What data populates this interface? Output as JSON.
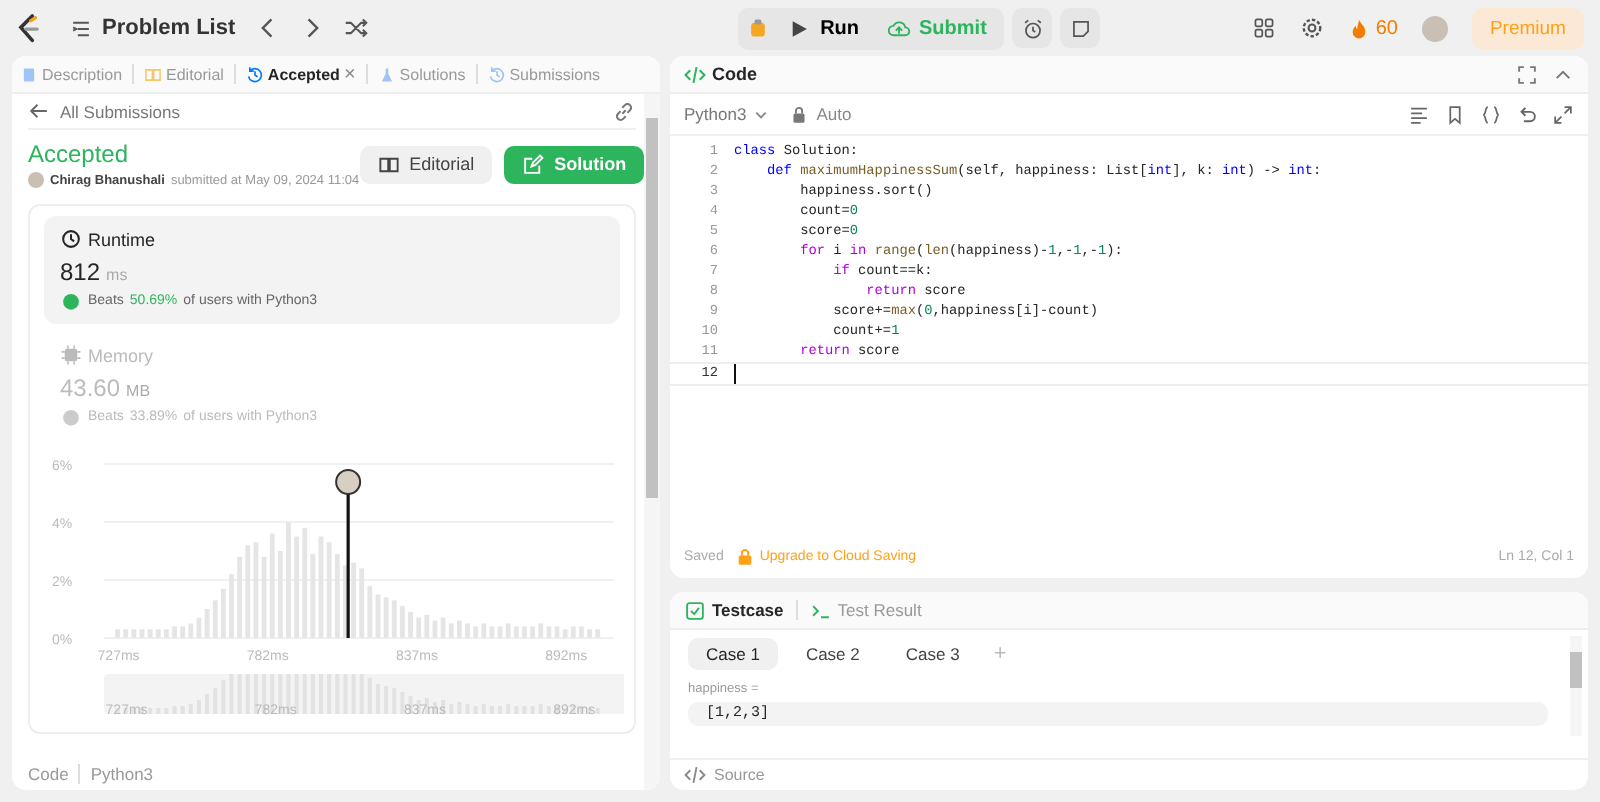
{
  "topbar": {
    "problem_list": "Problem List",
    "run": "Run",
    "submit": "Submit",
    "streak": "60",
    "premium": "Premium"
  },
  "left_tabs": [
    {
      "label": "Description",
      "selected": false,
      "closable": false
    },
    {
      "label": "Editorial",
      "selected": false,
      "closable": false
    },
    {
      "label": "Accepted",
      "selected": true,
      "closable": true,
      "close": "×"
    },
    {
      "label": "Solutions",
      "selected": false,
      "closable": false
    },
    {
      "label": "Submissions",
      "selected": false,
      "closable": false
    }
  ],
  "back_link": "All Submissions",
  "submission": {
    "status": "Accepted",
    "author": "Chirag Bhanushali",
    "submitted": "submitted at May 09, 2024 11:04",
    "buttons": [
      {
        "label": "Editorial",
        "kind": "secondary"
      },
      {
        "label": "Solution",
        "kind": "primary"
      }
    ]
  },
  "metrics": [
    {
      "title": "Runtime",
      "value": "812",
      "unit": "ms",
      "beats": "Beats",
      "percent": "50.69%",
      "rest": "of users with Python3",
      "selected": true
    },
    {
      "title": "Memory",
      "value": "43.60",
      "unit": "MB",
      "beats": "Beats",
      "percent": "33.89%",
      "rest": "of users with Python3",
      "selected": false
    }
  ],
  "chart_data": {
    "type": "bar",
    "x": [
      727,
      730,
      733,
      736,
      739,
      742,
      745,
      748,
      751,
      754,
      757,
      760,
      763,
      766,
      769,
      772,
      775,
      778,
      781,
      784,
      787,
      790,
      793,
      796,
      799,
      802,
      805,
      808,
      811,
      814,
      817,
      820,
      823,
      826,
      829,
      832,
      835,
      838,
      841,
      844,
      847,
      850,
      853,
      856,
      859,
      862,
      865,
      868,
      871,
      874,
      877,
      880,
      883,
      886,
      889,
      892,
      895,
      898,
      901,
      904
    ],
    "series": [
      {
        "color": "#e5e5e5",
        "values": [
          0.3,
          0.3,
          0.3,
          0.3,
          0.3,
          0.3,
          0.3,
          0.4,
          0.4,
          0.5,
          0.7,
          1.0,
          1.3,
          1.7,
          2.2,
          2.8,
          3.2,
          3.3,
          2.8,
          3.6,
          3.0,
          4.0,
          3.5,
          3.8,
          2.9,
          3.5,
          3.3,
          2.9,
          2.5,
          2.6,
          2.4,
          1.8,
          1.5,
          1.4,
          1.3,
          1.1,
          0.9,
          0.7,
          0.8,
          0.6,
          0.7,
          0.5,
          0.6,
          0.5,
          0.4,
          0.5,
          0.4,
          0.4,
          0.5,
          0.4,
          0.4,
          0.4,
          0.5,
          0.4,
          0.4,
          0.3,
          0.4,
          0.4,
          0.3,
          0.3
        ]
      }
    ],
    "xlim": [
      722,
      910
    ],
    "ylim": [
      0,
      6
    ],
    "xticks": [
      {
        "value": 727,
        "label": "727ms"
      },
      {
        "value": 782,
        "label": "782ms"
      },
      {
        "value": 837,
        "label": "837ms"
      },
      {
        "value": 892,
        "label": "892ms"
      }
    ],
    "yticks": [
      {
        "value": 0,
        "label": "0%"
      },
      {
        "value": 2,
        "label": "2%"
      },
      {
        "value": 4,
        "label": "4%"
      },
      {
        "value": 6,
        "label": "6%"
      }
    ]
  },
  "navigator": {
    "labels": [
      "727ms",
      "782ms",
      "837ms",
      "892ms"
    ]
  },
  "left_footer": {
    "label": "Code",
    "language": "Python3"
  },
  "code_panel": {
    "title": "Code",
    "language": "Python3",
    "mode": "Auto",
    "status": "Saved",
    "upgrade": "Upgrade to Cloud Saving",
    "position": "Ln 12, Col 1"
  },
  "code": [
    {
      "number": "1",
      "current": false,
      "tokens": [
        {
          "t": "class",
          "kind": "decl"
        },
        {
          "t": " Solution:",
          "kind": "plain"
        }
      ]
    },
    {
      "number": "2",
      "current": false,
      "tokens": [
        {
          "t": "    def",
          "kind": "decl"
        },
        {
          "t": " maximumHappinessSum",
          "kind": "function"
        },
        {
          "t": "(self, happiness: List[",
          "kind": "plain"
        },
        {
          "t": "int",
          "kind": "decl"
        },
        {
          "t": "], k: ",
          "kind": "plain"
        },
        {
          "t": "int",
          "kind": "decl"
        },
        {
          "t": ") -> ",
          "kind": "plain"
        },
        {
          "t": "int",
          "kind": "decl"
        },
        {
          "t": ":",
          "kind": "plain"
        }
      ]
    },
    {
      "number": "3",
      "current": false,
      "tokens": [
        {
          "t": "        happiness.sort()",
          "kind": "plain"
        }
      ]
    },
    {
      "number": "4",
      "current": false,
      "tokens": [
        {
          "t": "        count=",
          "kind": "plain"
        },
        {
          "t": "0",
          "kind": "number"
        }
      ]
    },
    {
      "number": "5",
      "current": false,
      "tokens": [
        {
          "t": "        score=",
          "kind": "plain"
        },
        {
          "t": "0",
          "kind": "number"
        }
      ]
    },
    {
      "number": "6",
      "current": false,
      "tokens": [
        {
          "t": "        for",
          "kind": "control"
        },
        {
          "t": " i ",
          "kind": "plain"
        },
        {
          "t": "in",
          "kind": "control"
        },
        {
          "t": " range",
          "kind": "builtin"
        },
        {
          "t": "(",
          "kind": "plain"
        },
        {
          "t": "len",
          "kind": "builtin"
        },
        {
          "t": "(happiness)-",
          "kind": "plain"
        },
        {
          "t": "1",
          "kind": "number"
        },
        {
          "t": ",-",
          "kind": "plain"
        },
        {
          "t": "1",
          "kind": "number"
        },
        {
          "t": ",-",
          "kind": "plain"
        },
        {
          "t": "1",
          "kind": "number"
        },
        {
          "t": "):",
          "kind": "plain"
        }
      ]
    },
    {
      "number": "7",
      "current": false,
      "tokens": [
        {
          "t": "            if",
          "kind": "control"
        },
        {
          "t": " count==k:",
          "kind": "plain"
        }
      ]
    },
    {
      "number": "8",
      "current": false,
      "tokens": [
        {
          "t": "                return",
          "kind": "control"
        },
        {
          "t": " score",
          "kind": "plain"
        }
      ]
    },
    {
      "number": "9",
      "current": false,
      "tokens": [
        {
          "t": "            score+=",
          "kind": "plain"
        },
        {
          "t": "max",
          "kind": "builtin"
        },
        {
          "t": "(",
          "kind": "plain"
        },
        {
          "t": "0",
          "kind": "number"
        },
        {
          "t": ",happiness[i]-count)",
          "kind": "plain"
        }
      ]
    },
    {
      "number": "10",
      "current": false,
      "tokens": [
        {
          "t": "            count+=",
          "kind": "plain"
        },
        {
          "t": "1",
          "kind": "number"
        }
      ]
    },
    {
      "number": "11",
      "current": false,
      "tokens": [
        {
          "t": "        return",
          "kind": "control"
        },
        {
          "t": " score",
          "kind": "plain"
        }
      ]
    },
    {
      "number": "12",
      "current": true
    }
  ],
  "test_tabs": [
    {
      "label": "Testcase",
      "selected": true
    },
    {
      "label": "Test Result",
      "selected": false
    }
  ],
  "cases": [
    {
      "label": "Case 1",
      "selected": true
    },
    {
      "label": "Case 2",
      "selected": false
    },
    {
      "label": "Case 3",
      "selected": false
    }
  ],
  "add_case": "+",
  "input": {
    "label": "happiness =",
    "value": "[1,2,3]"
  },
  "source": "Source"
}
